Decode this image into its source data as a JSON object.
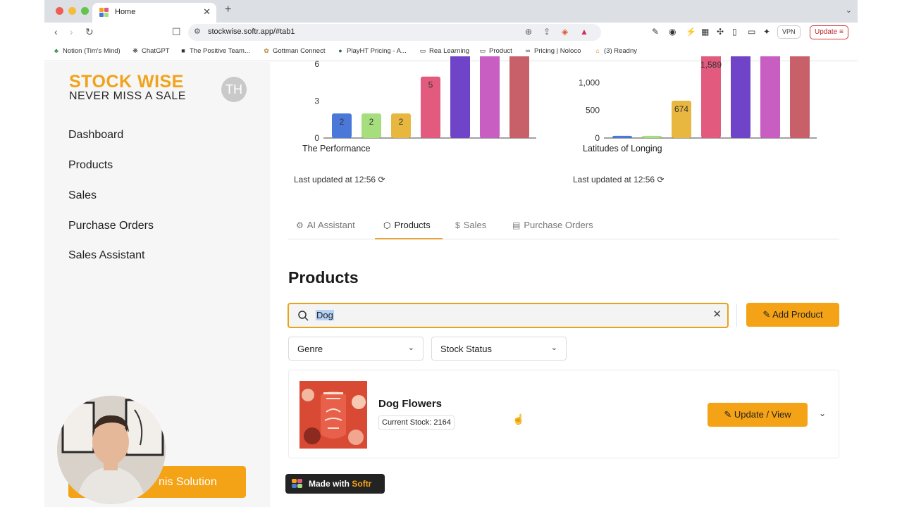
{
  "browser": {
    "tab_title": "Home",
    "url": "stockwise.softr.app/#tab1",
    "vpn_label": "VPN",
    "update_label": "Update",
    "bookmarks": [
      "Notion (Tim's Mind)",
      "ChatGPT",
      "The Positive Team...",
      "Gottman Connect",
      "PlayHT Pricing - A...",
      "Rea Learning",
      "Product",
      "Pricing | Noloco",
      "(3) Readny"
    ]
  },
  "brand": {
    "name": "STOCK WISE",
    "tagline": "NEVER MISS A SALE",
    "initials": "TH",
    "accent": "#f5a316"
  },
  "nav": [
    "Dashboard",
    "Products",
    "Sales",
    "Purchase Orders",
    "Sales Assistant"
  ],
  "cta_label": "nis Solution",
  "charts": {
    "left_caption": "The Performance",
    "right_caption": "Latitudes of Longing",
    "updated_text": "Last updated at 12:56",
    "left_ticks": [
      "6",
      "3",
      "0"
    ],
    "left_bars": [
      {
        "value": 2,
        "label": "2",
        "color": "#4a78d8"
      },
      {
        "value": 2,
        "label": "2",
        "color": "#a6de7e"
      },
      {
        "value": 2,
        "label": "2",
        "color": "#e8b740"
      },
      {
        "value": 5,
        "label": "5",
        "color": "#e25a7e"
      },
      {
        "value": 9,
        "label": "",
        "color": "#7044c8"
      },
      {
        "value": 9,
        "label": "",
        "color": "#c95ec2"
      },
      {
        "value": 9,
        "label": "",
        "color": "#c8606a"
      }
    ],
    "right_ticks": [
      "1,000",
      "500",
      "0"
    ],
    "right_bars": [
      {
        "value": 40,
        "label": "",
        "color": "#4a78d8"
      },
      {
        "value": 40,
        "label": "",
        "color": "#a6de7e"
      },
      {
        "value": 674,
        "label": "674",
        "color": "#e8b740"
      },
      {
        "value": 1589,
        "label": "1,589",
        "color": "#e25a7e"
      },
      {
        "value": 1700,
        "label": "",
        "color": "#7044c8"
      },
      {
        "value": 1700,
        "label": "",
        "color": "#c95ec2"
      },
      {
        "value": 1700,
        "label": "",
        "color": "#c8606a"
      }
    ]
  },
  "tabs": [
    {
      "label": "AI Assistant",
      "icon": "ai-icon"
    },
    {
      "label": "Products",
      "icon": "box-icon"
    },
    {
      "label": "Sales",
      "icon": "dollar-icon"
    },
    {
      "label": "Purchase Orders",
      "icon": "orders-icon"
    }
  ],
  "products": {
    "title": "Products",
    "search_value": "Dog",
    "add_label": "Add Product",
    "filters": [
      "Genre",
      "Stock Status"
    ],
    "items": [
      {
        "name": "Dog Flowers",
        "stock": "Current Stock: 2164",
        "action": "Update / View"
      }
    ]
  },
  "badge": {
    "prefix": "Made with",
    "brand": "Softr"
  }
}
